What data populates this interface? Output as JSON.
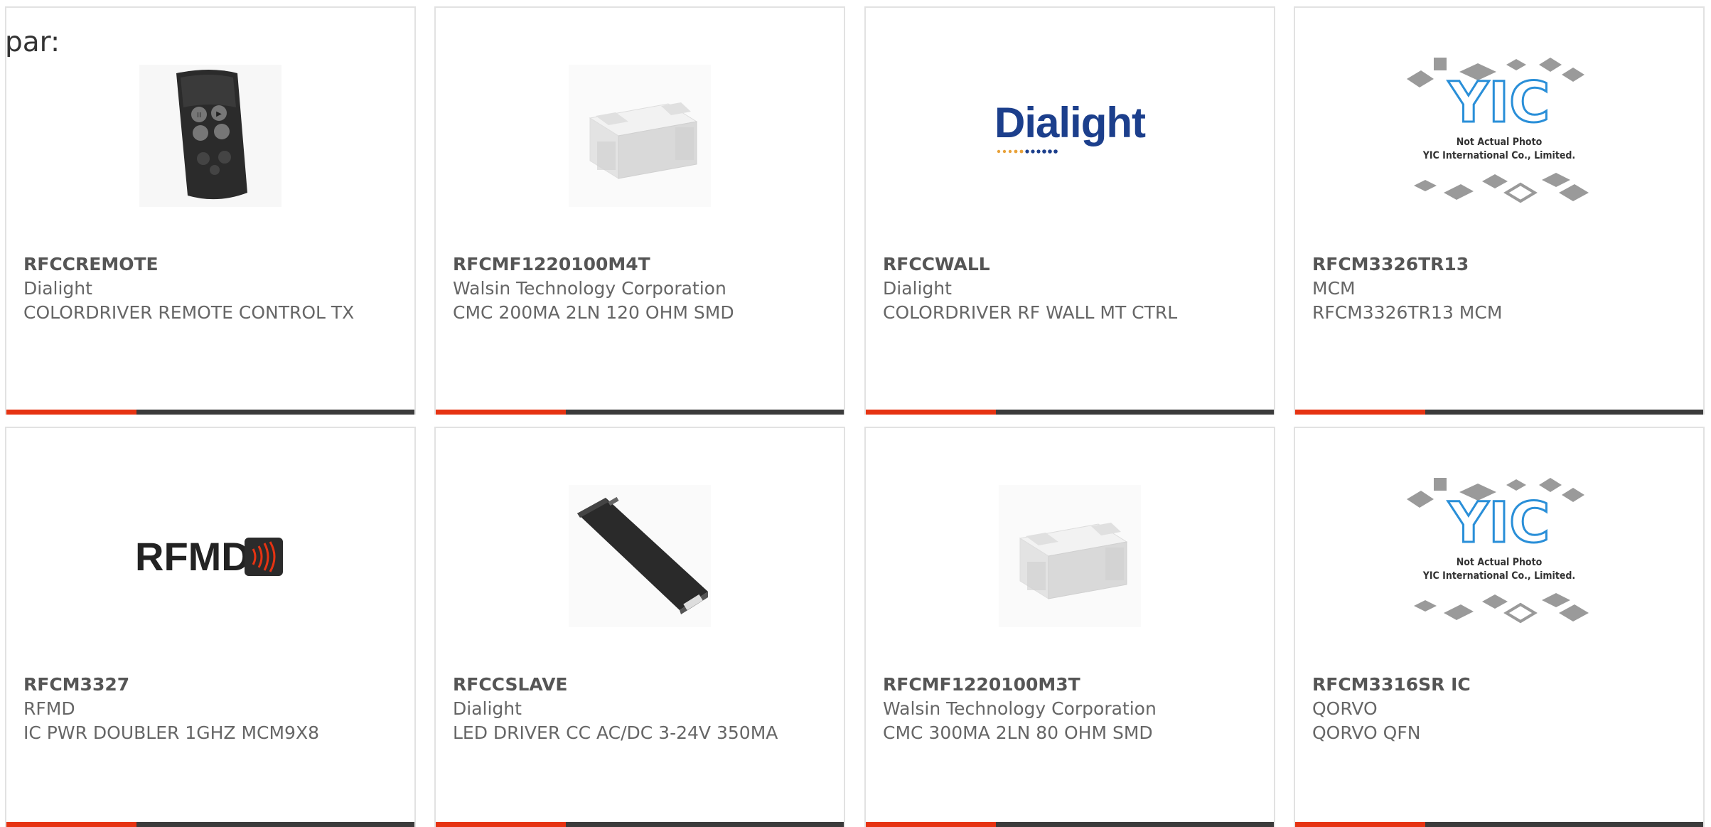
{
  "page": {
    "label": "par:"
  },
  "colors": {
    "accent": "#e63312",
    "bar": "#3b3b3b",
    "border": "#e2e2e2",
    "text": "#666666",
    "dialight_blue": "#1c3f8c",
    "yic_blue": "#2a8fd8"
  },
  "products": [
    {
      "part_number": "RFCCREMOTE",
      "manufacturer": "Dialight",
      "description": "COLORDRIVER REMOTE CONTROL TX",
      "image": "remote-control-photo"
    },
    {
      "part_number": "RFCMF1220100M4T",
      "manufacturer": "Walsin Technology Corporation",
      "description": "CMC 200MA 2LN 120 OHM SMD",
      "image": "smd-chip-photo"
    },
    {
      "part_number": "RFCCWALL",
      "manufacturer": "Dialight",
      "description": "COLORDRIVER RF WALL MT CTRL",
      "image": "dialight-logo",
      "logo_text": "Dialight"
    },
    {
      "part_number": "RFCM3326TR13",
      "manufacturer": "MCM",
      "description": "RFCM3326TR13 MCM",
      "image": "yic-placeholder",
      "placeholder_logo": "YIC",
      "placeholder_line1": "Not Actual Photo",
      "placeholder_line2": "YIC International Co., Limited."
    },
    {
      "part_number": "RFCM3327",
      "manufacturer": "RFMD",
      "description": "IC PWR DOUBLER 1GHZ MCM9X8",
      "image": "rfmd-logo",
      "logo_text": "RFMD"
    },
    {
      "part_number": "RFCCSLAVE",
      "manufacturer": "Dialight",
      "description": "LED DRIVER CC AC/DC 3-24V 350MA",
      "image": "led-driver-photo"
    },
    {
      "part_number": "RFCMF1220100M3T",
      "manufacturer": "Walsin Technology Corporation",
      "description": "CMC 300MA 2LN 80 OHM SMD",
      "image": "smd-chip-photo"
    },
    {
      "part_number": "RFCM3316SR IC",
      "manufacturer": "QORVO",
      "description": "QORVO QFN",
      "image": "yic-placeholder",
      "placeholder_logo": "YIC",
      "placeholder_line1": "Not Actual Photo",
      "placeholder_line2": "YIC International Co., Limited."
    }
  ]
}
